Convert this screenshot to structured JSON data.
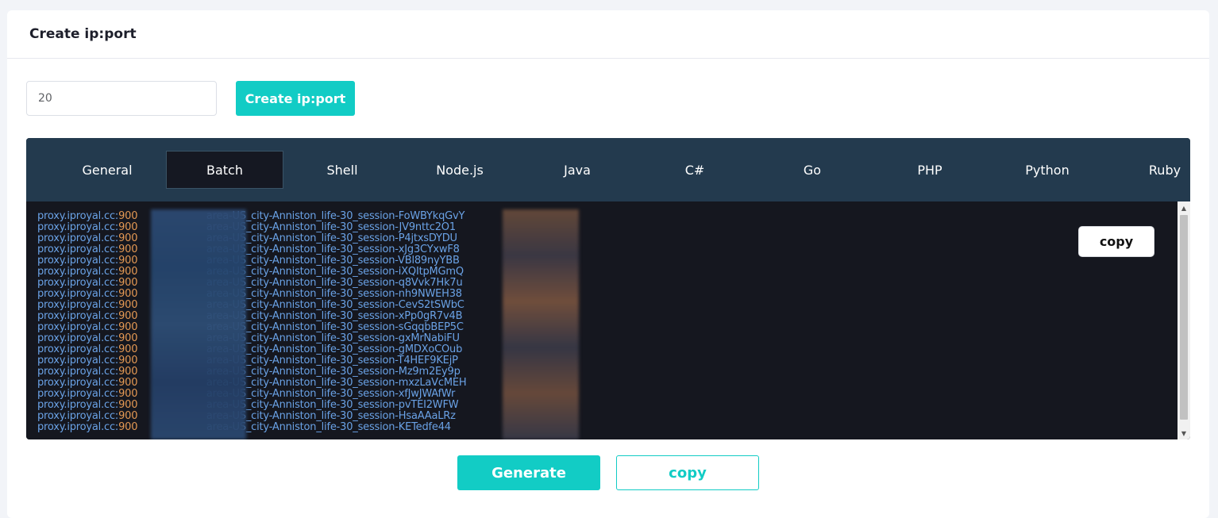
{
  "header": {
    "title": "Create ip:port"
  },
  "form": {
    "count_value": "20",
    "create_label": "Create ip:port"
  },
  "tabs": [
    {
      "label": "General"
    },
    {
      "label": "Batch"
    },
    {
      "label": "Shell"
    },
    {
      "label": "Node.js"
    },
    {
      "label": "Java"
    },
    {
      "label": "C#"
    },
    {
      "label": "Go"
    },
    {
      "label": "PHP"
    },
    {
      "label": "Python"
    },
    {
      "label": "Ruby"
    }
  ],
  "active_tab": "Batch",
  "code": {
    "host": "proxy.iproyal.cc:",
    "port_prefix": "900",
    "middle": "area-US_city-Anniston_life-30_session-",
    "sessions": [
      "FoWBYkqGvY",
      "JV9nttc2O1",
      "P4jtxsDYDU",
      "xJg3CYxwF8",
      "VBl89nyYBB",
      "iXQItpMGmQ",
      "q8Vvk7Hk7u",
      "nh9NWEH38",
      "CevS2tSWbC",
      "xPp0gR7v4B",
      "sGqqbBEP5C",
      "gxMrNabiFU",
      "gMDXoCOub",
      "T4HEF9KEjP",
      "Mz9m2Ey9p",
      "mxzLaVcMEH",
      "xfJwJWAfWr",
      "pvTEI2WFW",
      "HsaAAaLRz",
      "KETedfe44"
    ]
  },
  "copy_inner_label": "copy",
  "footer": {
    "generate_label": "Generate",
    "copy_label": "copy"
  },
  "colors": {
    "accent": "#12ccc5",
    "tabbar": "#233a4e",
    "code_bg": "#15171f",
    "code_text": "#6aa2e6",
    "port_text": "#e39853"
  }
}
